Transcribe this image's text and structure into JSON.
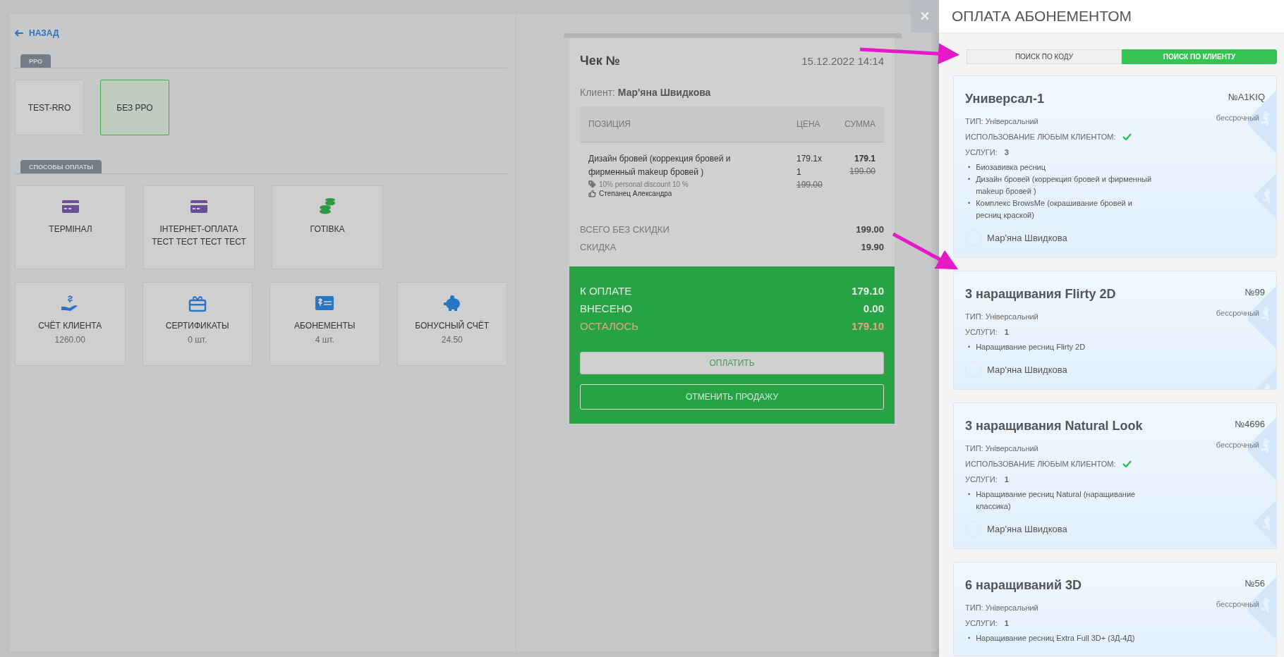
{
  "back_link": {
    "label": "НАЗАД"
  },
  "rro": {
    "tab": "РРО",
    "options": [
      {
        "label": "TEST-RRO",
        "selected": false
      },
      {
        "label": "БЕЗ РРО",
        "selected": true
      }
    ]
  },
  "payment_methods": {
    "tab": "СПОСОБЫ ОПЛАТЫ",
    "rows": [
      [
        {
          "kind": "card",
          "label": "ТЕРМІНАЛ"
        },
        {
          "kind": "card",
          "label": "ІНТЕРНЕТ-ОПЛАТА ТЕСТ ТЕСТ ТЕСТ ТЕСТ"
        },
        {
          "kind": "cash",
          "label": "ГОТІВКА"
        }
      ],
      [
        {
          "kind": "account",
          "label": "СЧЁТ КЛИЕНТА",
          "sub": "1260.00"
        },
        {
          "kind": "certificate",
          "label": "СЕРТИФИКАТЫ",
          "sub": "0 шт."
        },
        {
          "kind": "subscription",
          "label": "АБОНЕМЕНТЫ",
          "sub": "4 шт."
        },
        {
          "kind": "bonus",
          "label": "БОНУСНЫЙ СЧЁТ",
          "sub": "24.50"
        }
      ]
    ]
  },
  "receipt": {
    "title": "Чек №",
    "datetime": "15.12.2022 14:14",
    "client": "Клиент: **Мар'яна Швидкова**",
    "columns": [
      "ПОЗИЦИЯ",
      "ЦЕНА",
      "СУММА"
    ],
    "items": [
      {
        "name": "Дизайн бровей (коррекция бровей и фирменный makeup бровей )",
        "discount": "10% personal discount 10 %",
        "staff": "Степанец Александра",
        "price": "179.1x 1",
        "old_price": "199.00",
        "sum": "179.1",
        "old_sum": "199.00"
      }
    ],
    "subtotals": [
      {
        "label": "ВСЕГО БЕЗ СКИДКИ",
        "value": "199.00"
      },
      {
        "label": "СКИДКА",
        "value": "19.90"
      }
    ],
    "totals": [
      {
        "label": "К ОПЛАТЕ",
        "value": "179.10",
        "highlight": false
      },
      {
        "label": "ВНЕСЕНО",
        "value": "0.00",
        "highlight": false
      },
      {
        "label": "ОСТАЛОСЬ",
        "value": "179.10",
        "highlight": true
      }
    ],
    "buttons": [
      {
        "label": "ОПЛАТИТЬ",
        "kind": "filled"
      },
      {
        "label": "ОТМЕНИТЬ ПРОДАЖУ",
        "kind": "outline"
      }
    ]
  },
  "drawer": {
    "close_button": "×",
    "title": "ОПЛАТА АБОНЕМЕНТОМ",
    "tabs": [
      {
        "label": "ПОИСК ПО КОДУ",
        "selected": false
      },
      {
        "label": "ПОИСК ПО КЛИЕНТУ",
        "selected": true
      }
    ],
    "subscriptions": [
      {
        "name": "Универсал-1",
        "number": "№A1KIQ",
        "validity": "бессрочный",
        "type": "ТИП: Універсальний",
        "any_client": true,
        "any_client_label": "ИСПОЛЬЗОВАНИЕ ЛЮБЫМ КЛИЕНТОМ:",
        "services_count": "УСЛУГИ: **3**",
        "services": [
          {
            "bullet": "•",
            "text": "Биозавивка ресниц"
          },
          {
            "bullet": "•",
            "text": "Дизайн бровей (коррекция бровей и фирменный makeup бровей )"
          },
          {
            "bullet": "•",
            "text": "Комплекс BrowsMe (окрашивание бровей и ресниц краской)"
          }
        ],
        "client": "Мар'яна Швидкова"
      },
      {
        "name": "3 наращивания Flirty 2D",
        "number": "№99",
        "validity": "бессрочный",
        "type": "ТИП: Універсальний",
        "any_client": false,
        "services_count": "УСЛУГИ: **1**",
        "services": [
          {
            "bullet": "•",
            "text": "Наращивание ресниц Flirty 2D"
          }
        ],
        "client": "Мар'яна Швидкова"
      },
      {
        "name": "3 наращивания Natural Look",
        "number": "№4696",
        "validity": "бессрочный",
        "type": "ТИП: Універсальний",
        "any_client": true,
        "any_client_label": "ИСПОЛЬЗОВАНИЕ ЛЮБЫМ КЛИЕНТОМ:",
        "services_count": "УСЛУГИ: **1**",
        "services": [
          {
            "bullet": "•",
            "text": "Наращивание ресниц Natural (наращивание классика)"
          }
        ],
        "client": "Мар'яна Швидкова"
      },
      {
        "name": "6 наращиваний 3D",
        "number": "№56",
        "validity": "бессрочный",
        "type": "ТИП: Універсальний",
        "any_client": false,
        "services_count": "УСЛУГИ: **1**",
        "services": [
          {
            "bullet": "•",
            "text": "Наращивание ресниц Extra Full 3D+ (3Д-4Д)"
          }
        ]
      }
    ]
  }
}
